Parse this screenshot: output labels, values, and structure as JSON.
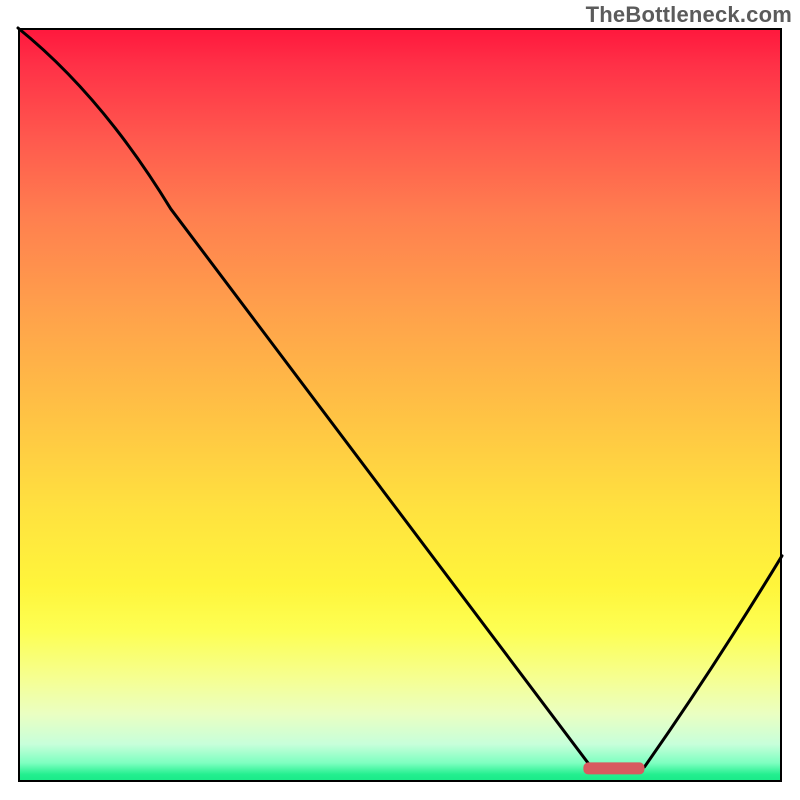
{
  "watermark": "TheBottleneck.com",
  "chart_data": {
    "type": "line",
    "title": "",
    "xlabel": "",
    "ylabel": "",
    "xlim": [
      0,
      100
    ],
    "ylim": [
      0,
      100
    ],
    "grid": false,
    "legend": false,
    "x": [
      0,
      20,
      75,
      82,
      100
    ],
    "values": [
      100,
      76,
      2,
      2,
      30
    ],
    "annotations": [
      {
        "type": "marker",
        "x_start": 74,
        "x_end": 82,
        "y": 1.8,
        "color": "#d75a5f"
      }
    ],
    "background": {
      "type": "vertical_gradient",
      "stops": [
        {
          "pos": 0,
          "color": "#ff173d"
        },
        {
          "pos": 0.5,
          "color": "#ffd940"
        },
        {
          "pos": 0.8,
          "color": "#fdff53"
        },
        {
          "pos": 1.0,
          "color": "#18e987"
        }
      ]
    }
  }
}
